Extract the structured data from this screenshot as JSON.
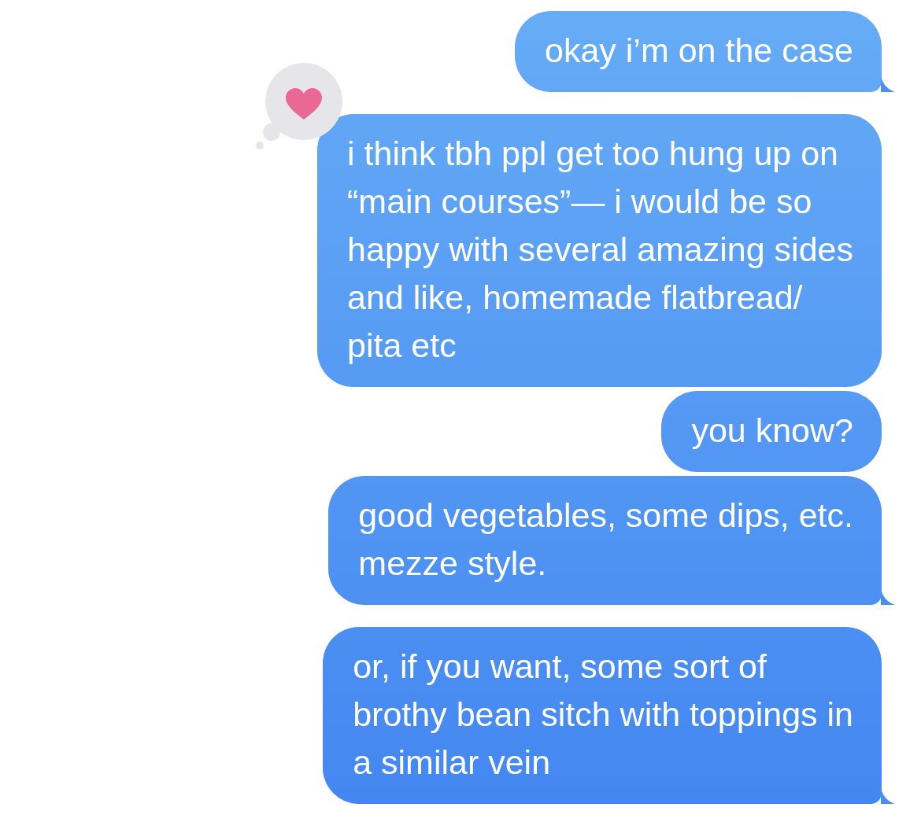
{
  "messages": [
    {
      "text": "okay i’m on the case",
      "tail": true
    },
    {
      "text": "i think tbh ppl get too hung up on\n“main courses”— i would be so\nhappy with several amazing sides\nand like, homemade flatbread/\npita etc",
      "tail": false,
      "tapback": {
        "kind": "heart"
      }
    },
    {
      "text": "you know?",
      "tail": false
    },
    {
      "text": "good vegetables, some dips, etc.\nmezze style.",
      "tail": true
    },
    {
      "text": "or, if you want, some sort of\nbrothy bean sitch with toppings in\na similar vein",
      "tail": true
    }
  ]
}
